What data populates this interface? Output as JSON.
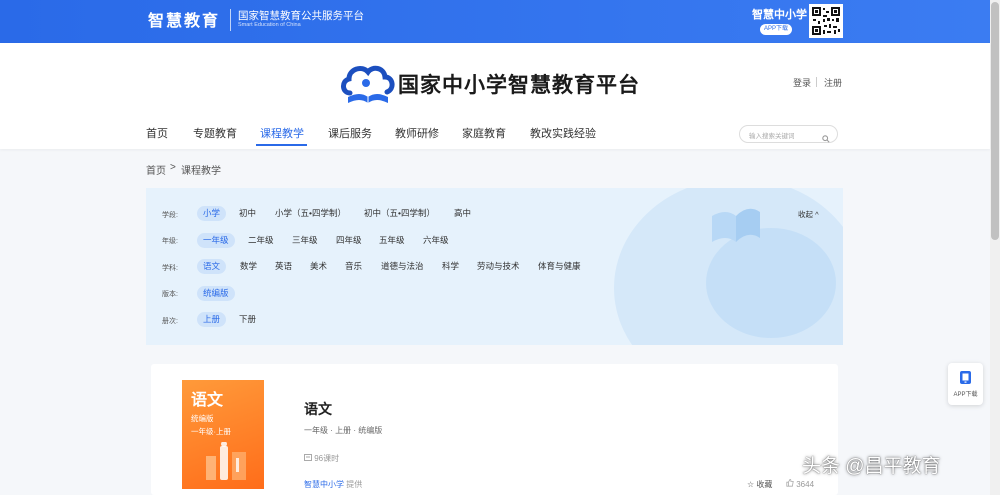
{
  "topbar": {
    "brand": "智慧教育",
    "platform_cn": "国家智慧教育公共服务平台",
    "platform_en": "Smart Education of China",
    "app_title": "智慧中小学",
    "app_download": "APP下载"
  },
  "header": {
    "logo_text": "国家中小学智慧教育平台",
    "login": "登录",
    "register": "注册",
    "search_placeholder": "输入搜索关键词"
  },
  "nav": {
    "items": [
      "首页",
      "专题教育",
      "课程教学",
      "课后服务",
      "教师研修",
      "家庭教育",
      "教改实践经验"
    ],
    "active": "课程教学"
  },
  "breadcrumb": {
    "home": "首页",
    "separator": ">",
    "current": "课程教学"
  },
  "filters": {
    "collapse_label": "收起",
    "rows": [
      {
        "label": "学段:",
        "options": [
          "小学",
          "初中",
          "小学（五•四学制）",
          "初中（五•四学制）",
          "高中"
        ],
        "selected": "小学"
      },
      {
        "label": "年级:",
        "options": [
          "一年级",
          "二年级",
          "三年级",
          "四年级",
          "五年级",
          "六年级"
        ],
        "selected": "一年级"
      },
      {
        "label": "学科:",
        "options": [
          "语文",
          "数学",
          "英语",
          "美术",
          "音乐",
          "道德与法治",
          "科学",
          "劳动与技术",
          "体育与健康"
        ],
        "selected": "语文"
      },
      {
        "label": "版本:",
        "options": [
          "统编版"
        ],
        "selected": "统编版"
      },
      {
        "label": "册次:",
        "options": [
          "上册",
          "下册"
        ],
        "selected": "上册"
      }
    ]
  },
  "course": {
    "cover_title": "语文",
    "cover_edition": "统编版",
    "cover_grade": "一年级·上册",
    "title": "语文",
    "meta": "一年级 · 上册 · 统编版",
    "lessons": "96课时",
    "provider": "智慧中小学",
    "provider_suffix": "提供",
    "favorite": "收藏",
    "likes": "3644"
  },
  "float_panel": {
    "label": "APP下载"
  },
  "watermark": "头条 @昌平教育",
  "colors": {
    "primary": "#2a6ae8",
    "filter_bg": "#e6f2fc",
    "cover_orange": "#ff7a1f"
  }
}
